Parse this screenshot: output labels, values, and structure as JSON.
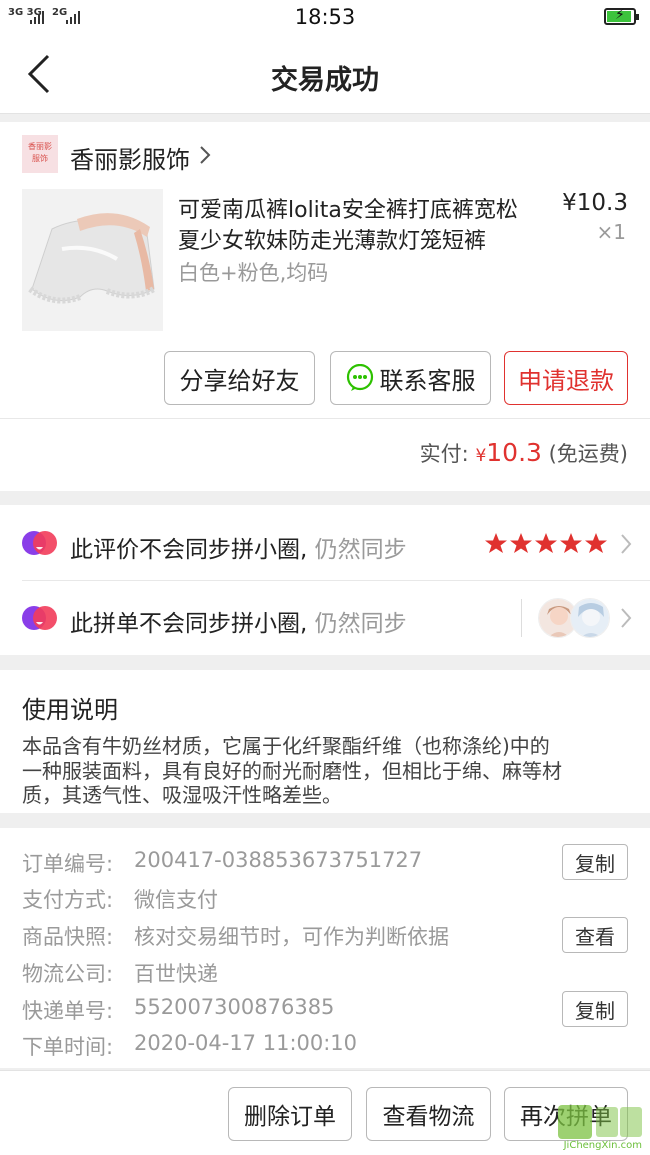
{
  "status_bar": {
    "signal_1": "3G 3G",
    "signal_2": "2G",
    "time": "18:53",
    "battery_icon": "battery-charging-icon"
  },
  "nav": {
    "back_icon": "chevron-left-icon",
    "title": "交易成功"
  },
  "store": {
    "logo_text": "香丽影服饰",
    "name": "香丽影服饰",
    "chevron_icon": "chevron-right-icon"
  },
  "product": {
    "title_line_1": "可爱南瓜裤lolita安全裤打底裤宽松",
    "title_line_2": "夏少女软妹防走光薄款灯笼短裤",
    "variant": "白色+粉色,均码",
    "price": "¥10.3",
    "quantity": "×1"
  },
  "actions": {
    "share": "分享给好友",
    "contact": "联系客服",
    "refund": "申请退款"
  },
  "payment": {
    "label": "实付: ",
    "currency": "¥",
    "amount": "10.3",
    "shipping_note": " (免运费)"
  },
  "community": {
    "review_row": {
      "text": "此评价不会同步拼小圈,",
      "action": " 仍然同步",
      "rating": 5
    },
    "group_row": {
      "text": "此拼单不会同步拼小圈,",
      "action": " 仍然同步"
    }
  },
  "usage": {
    "title": "使用说明",
    "line_1": "本品含有牛奶丝材质，它属于化纤聚酯纤维（也称涤纶)中的",
    "line_2": "一种服装面料，具有良好的耐光耐磨性，但相比于绵、麻等材",
    "line_3": "质，其透气性、吸湿吸汗性略差些。"
  },
  "order_info": {
    "order_no_label": "订单编号:",
    "order_no": "200417-038853673751727",
    "copy_label": "复制",
    "payment_method_label": "支付方式:",
    "payment_method": "微信支付",
    "snapshot_label": "商品快照:",
    "snapshot": "核对交易细节时，可作为判断依据",
    "view_label": "查看",
    "logistics_label": "物流公司:",
    "logistics": "百世快递",
    "tracking_label": "快递单号:",
    "tracking_no": "552007300876385",
    "copy_label_2": "复制",
    "order_time_label": "下单时间:",
    "order_time": "2020-04-17 11:00:10"
  },
  "bottom_bar": {
    "delete": "删除订单",
    "logistics": "查看物流",
    "reorder": "再次拼单"
  },
  "watermark": {
    "text": "JiChengXin.com"
  },
  "colors": {
    "accent_red": "#e0322f",
    "star_red": "#e0322f",
    "wechat_green": "#2dc100",
    "pdd_purple": "#8a3ee8",
    "pdd_red": "#f23c5a"
  }
}
